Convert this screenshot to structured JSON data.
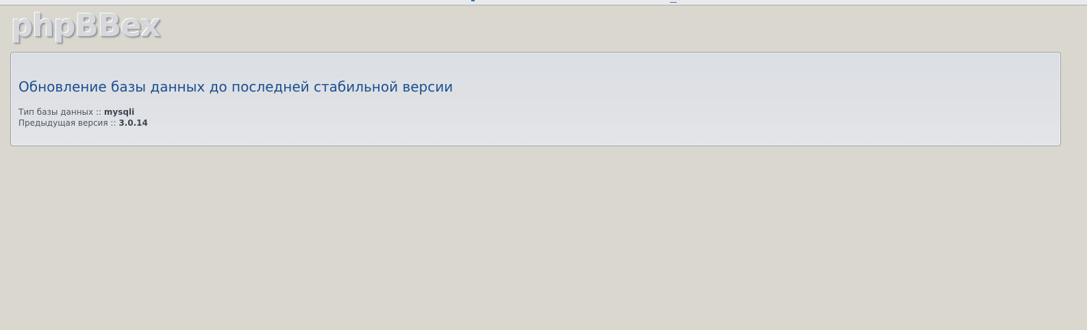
{
  "logo": {
    "text": "phpBBex"
  },
  "panel": {
    "title": "Обновление базы данных до последней стабильной версии",
    "db_type_label": "Тип базы данных",
    "db_type_value": "mysqli",
    "prev_version_label": "Предыдущая версия",
    "prev_version_value": "3.0.14",
    "separator": "::"
  },
  "colors": {
    "background": "#dad7cf",
    "panel_background": "#dfe1e5",
    "title": "#1b4f91",
    "text": "#4a5564"
  }
}
